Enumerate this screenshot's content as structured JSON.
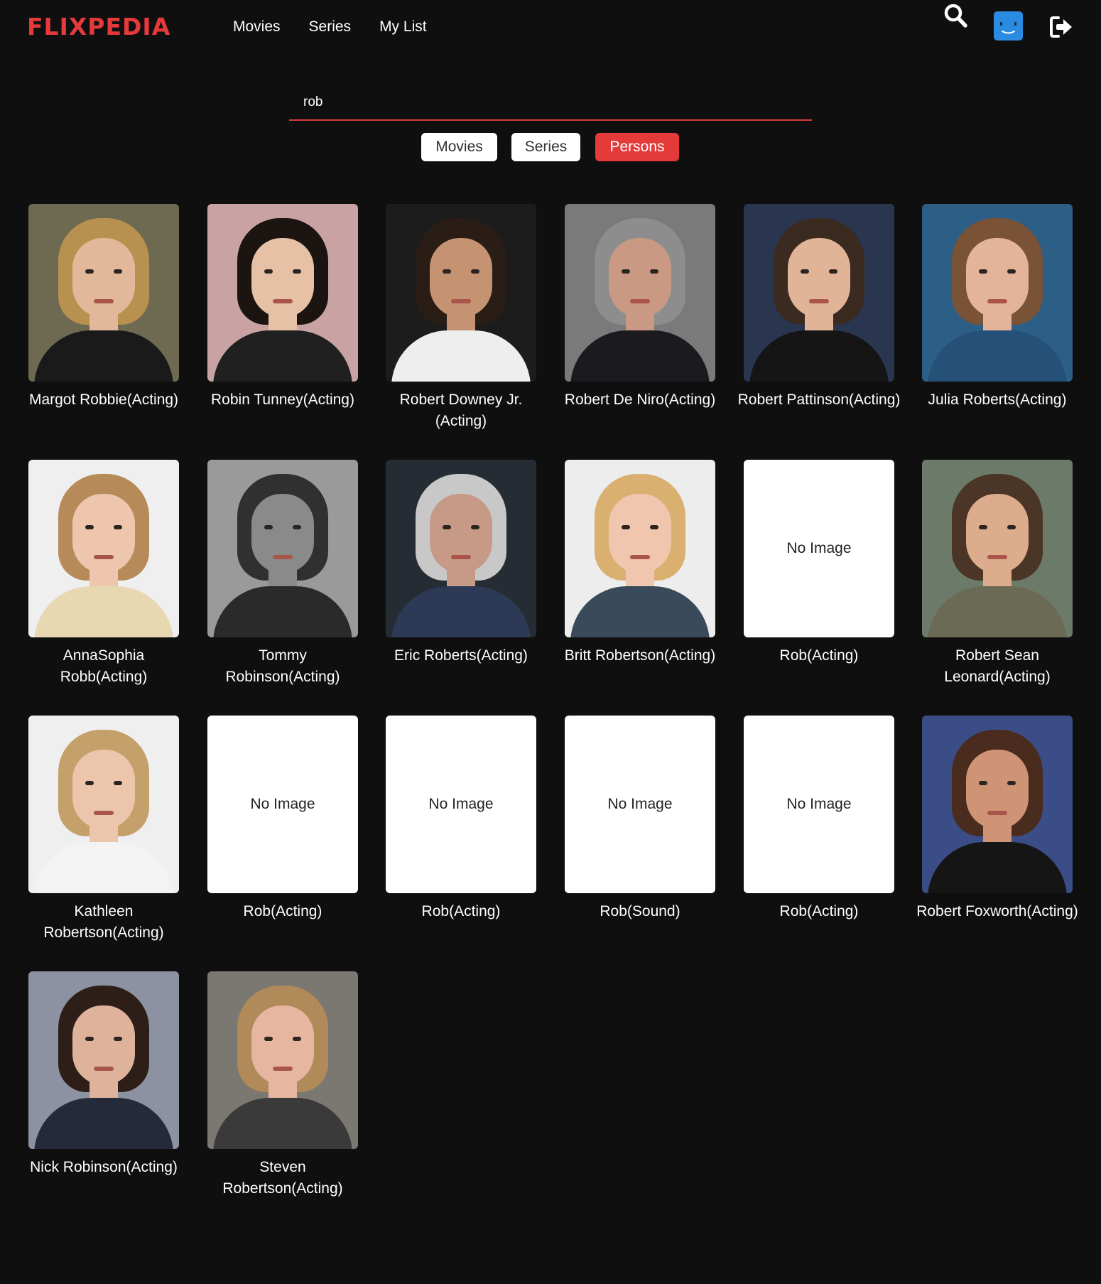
{
  "app": {
    "logo": "FLIXPEDIA",
    "nav": [
      "Movies",
      "Series",
      "My List"
    ]
  },
  "search": {
    "value": "rob"
  },
  "filters": {
    "movies": "Movies",
    "series": "Series",
    "persons": "Persons",
    "active": "Persons"
  },
  "no_image_label": "No Image",
  "persons": [
    {
      "name": "Margot Robbie(Acting)",
      "has_image": true
    },
    {
      "name": "Robin Tunney(Acting)",
      "has_image": true
    },
    {
      "name": "Robert Downey Jr.(Acting)",
      "has_image": true
    },
    {
      "name": "Robert De Niro(Acting)",
      "has_image": true
    },
    {
      "name": "Robert Pattinson(Acting)",
      "has_image": true
    },
    {
      "name": "Julia Roberts(Acting)",
      "has_image": true
    },
    {
      "name": "AnnaSophia Robb(Acting)",
      "has_image": true
    },
    {
      "name": "Tommy Robinson(Acting)",
      "has_image": true
    },
    {
      "name": "Eric Roberts(Acting)",
      "has_image": true
    },
    {
      "name": "Britt Robertson(Acting)",
      "has_image": true
    },
    {
      "name": "Rob(Acting)",
      "has_image": false
    },
    {
      "name": "Robert Sean Leonard(Acting)",
      "has_image": true
    },
    {
      "name": "Kathleen Robertson(Acting)",
      "has_image": true
    },
    {
      "name": "Rob(Acting)",
      "has_image": false
    },
    {
      "name": "Rob(Acting)",
      "has_image": false
    },
    {
      "name": "Rob(Sound)",
      "has_image": false
    },
    {
      "name": "Rob(Acting)",
      "has_image": false
    },
    {
      "name": "Robert Foxworth(Acting)",
      "has_image": true
    },
    {
      "name": "Nick Robinson(Acting)",
      "has_image": true
    },
    {
      "name": "Steven Robertson(Acting)",
      "has_image": true
    }
  ],
  "colors": {
    "accent": "#e53a3a",
    "background": "#0f0f10",
    "avatar": "#2a8be2"
  }
}
